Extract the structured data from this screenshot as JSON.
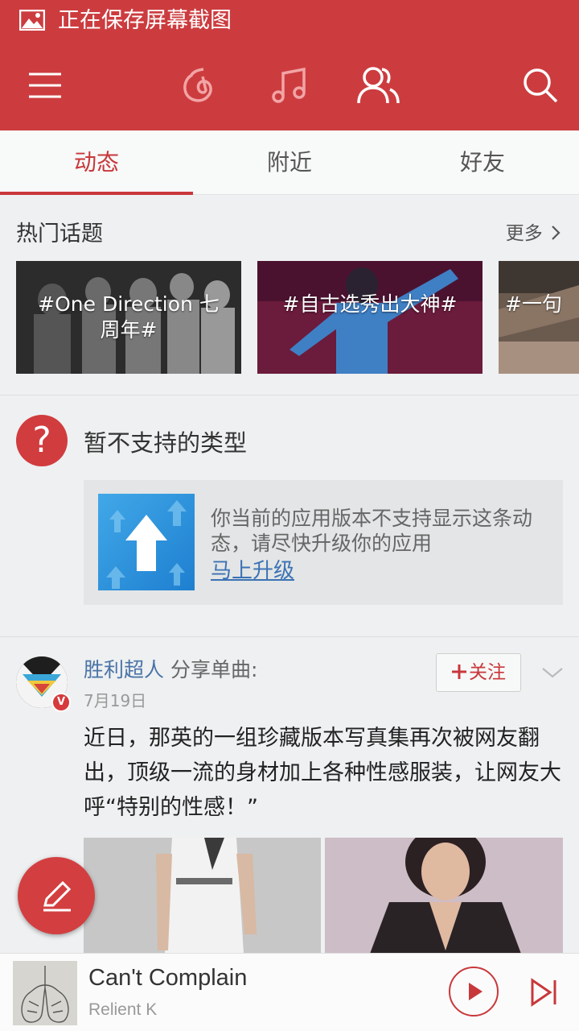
{
  "status_bar": {
    "text": "正在保存屏幕截图"
  },
  "nav": {
    "icons": [
      "menu-icon",
      "netease-music-icon",
      "music-note-icon",
      "friends-icon",
      "search-icon"
    ]
  },
  "tabs": [
    {
      "label": "动态",
      "active": true
    },
    {
      "label": "附近",
      "active": false
    },
    {
      "label": "好友",
      "active": false
    }
  ],
  "hot_topics": {
    "title": "热门话题",
    "more": "更多",
    "items": [
      {
        "label": "#One Direction 七周年#"
      },
      {
        "label": "#自古选秀出大神#"
      },
      {
        "label": "#一句"
      }
    ]
  },
  "unsupported": {
    "title": "暂不支持的类型",
    "message": "你当前的应用版本不支持显示这条动态，请尽快升级你的应用",
    "link": "马上升级"
  },
  "post": {
    "author": "胜利超人",
    "action": " 分享单曲:",
    "date": "7月19日",
    "follow": "关注",
    "verified": "V",
    "text": "近日，那英的一组珍藏版本写真集再次被网友翻出，顶级一流的身材加上各种性感服装，让网友大呼“特别的性感！”"
  },
  "player": {
    "song": "Can't Complain",
    "artist": "Relient K"
  },
  "colors": {
    "accent": "#cc3c3f",
    "link": "#4a73a6"
  }
}
